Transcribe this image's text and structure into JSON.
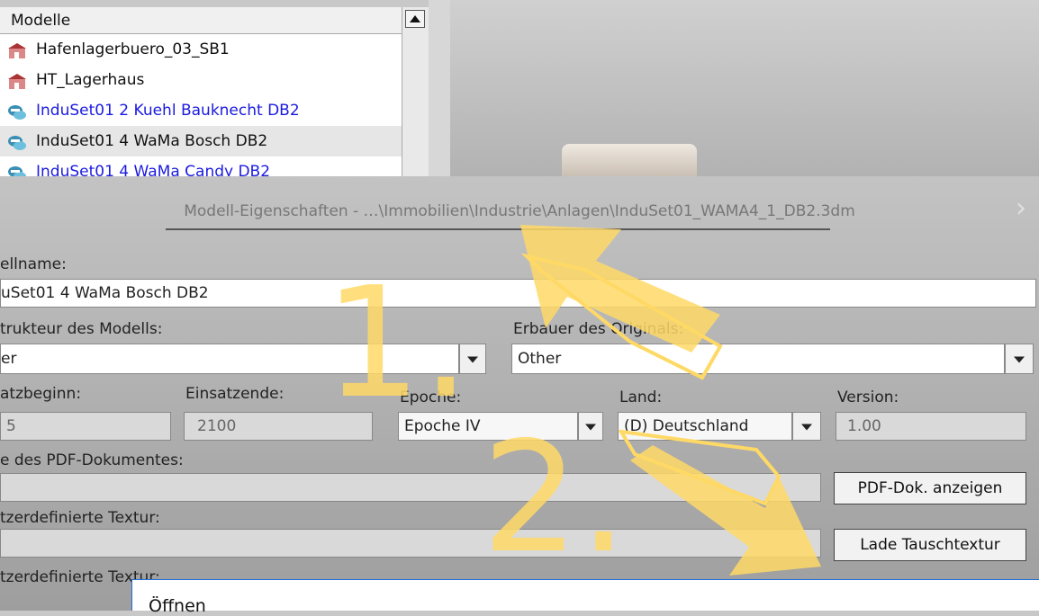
{
  "model_list": {
    "header": "Modelle",
    "items": [
      {
        "label": "Hafenlagerbuero_03_SB1",
        "color": "#111111",
        "icon": "building-icon"
      },
      {
        "label": "HT_Lagerhaus",
        "color": "#111111",
        "icon": "building-icon"
      },
      {
        "label": "InduSet01 2 Kuehl Bauknecht DB2",
        "color": "#1a1ae0",
        "icon": "model-set-icon"
      },
      {
        "label": "InduSet01 4 WaMa Bosch DB2",
        "color": "#111111",
        "icon": "model-set-icon"
      },
      {
        "label": "InduSet01 4 WaMa Candy DB2",
        "color": "#1a1ae0",
        "icon": "model-set-icon"
      }
    ]
  },
  "dialog": {
    "title": "Modell-Eigenschaften - …\\Immobilien\\Industrie\\Anlagen\\InduSet01_WAMA4_1_DB2.3dm",
    "fields": {
      "modelname_label": "ellname:",
      "modelname_value": "uSet01 4 WaMa Bosch DB2",
      "constructor_label": "trukteur des Modells:",
      "constructor_value": "er",
      "builder_label": "Erbauer des Originals:",
      "builder_value": "Other",
      "start_label": "atzbeginn:",
      "start_value": "5",
      "end_label": "Einsatzende:",
      "end_value": "2100",
      "epoch_label": "Epoche:",
      "epoch_value": "Epoche IV",
      "country_label": "Land:",
      "country_value": "(D) Deutschland",
      "version_label": "Version:",
      "version_value": "1.00",
      "pdf_label": "e des PDF-Dokumentes:",
      "pdf_button": "PDF-Dok. anzeigen",
      "texture_label": "tzerdefinierte Textur:",
      "texture_button": "Lade Tauschtextur",
      "texture2_label": "tzerdefinierte Textur:"
    }
  },
  "open_dialog": {
    "title": "Öffnen"
  },
  "annotations": {
    "step1": "1.",
    "step2": "2.",
    "color": "#ffd966"
  }
}
